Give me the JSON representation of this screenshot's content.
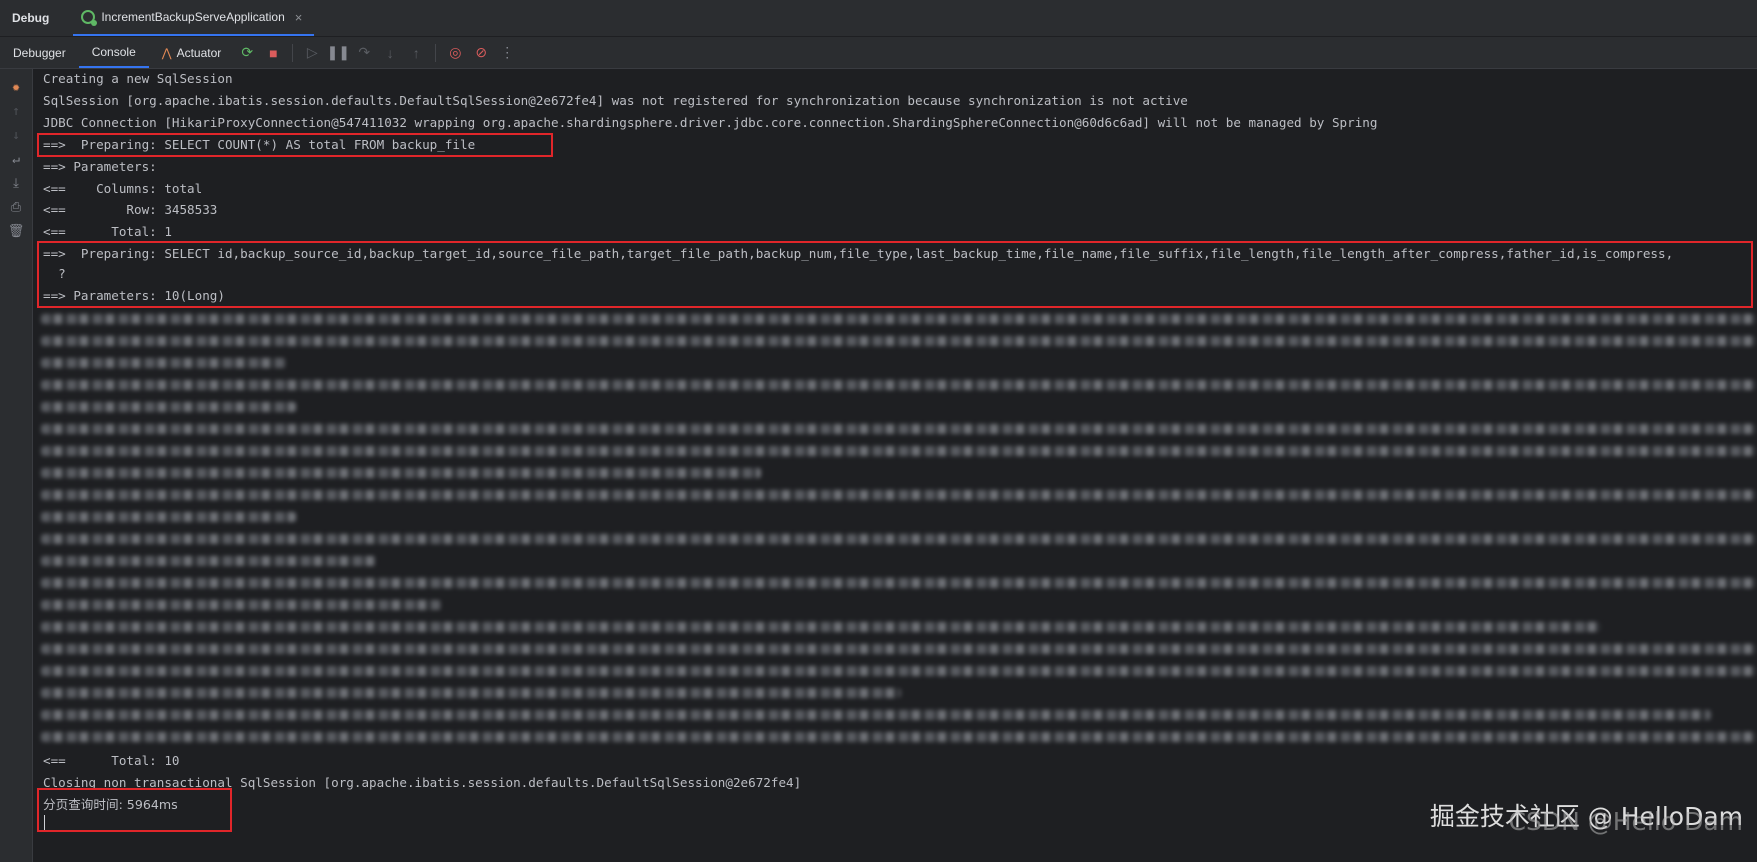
{
  "debug_label": "Debug",
  "run_tab": {
    "name": "IncrementBackupServeApplication",
    "close": "×"
  },
  "toolbar": {
    "tabs": [
      "Debugger",
      "Console",
      "Actuator"
    ],
    "active_tab": "Console"
  },
  "console_lines": [
    "Creating a new SqlSession",
    "SqlSession [org.apache.ibatis.session.defaults.DefaultSqlSession@2e672fe4] was not registered for synchronization because synchronization is not active",
    "JDBC Connection [HikariProxyConnection@547411032 wrapping org.apache.shardingsphere.driver.jdbc.core.connection.ShardingSphereConnection@60d6c6ad] will not be managed by Spring",
    "==>  Preparing: SELECT COUNT(*) AS total FROM backup_file",
    "==> Parameters: ",
    "<==    Columns: total",
    "<==        Row: 3458533",
    "<==      Total: 1",
    "==>  Preparing: SELECT id,backup_source_id,backup_target_id,source_file_path,target_file_path,backup_num,file_type,last_backup_time,file_name,file_suffix,file_length,file_length_after_compress,father_id,is_compress,",
    "  ?",
    "==> Parameters: 10(Long)"
  ],
  "console_tail": [
    "<==      Total: 10",
    "Closing non transactional SqlSession [org.apache.ibatis.session.defaults.DefaultSqlSession@2e672fe4]",
    "分页查询时间: 5964ms"
  ],
  "watermark": {
    "primary": "掘金技术社区 @ HelloDam",
    "secondary": "CSDN @Hello Dam"
  },
  "colors": {
    "background": "#1e1f22",
    "text": "#bcbec4",
    "highlight_box": "#e0262a",
    "accent": "#3574f0"
  }
}
